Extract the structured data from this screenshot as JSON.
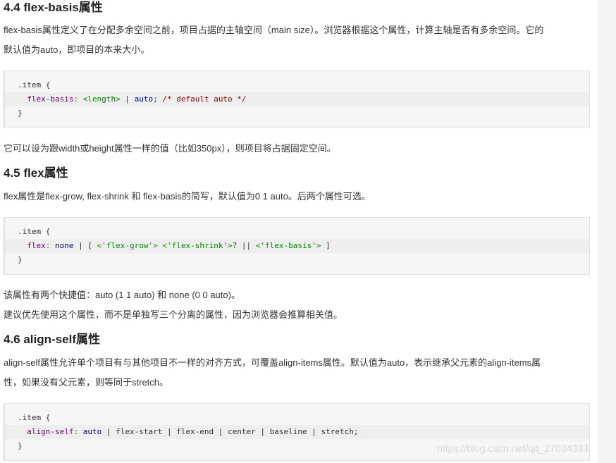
{
  "sections": [
    {
      "heading": "4.4 flex-basis属性",
      "para1_line1": "flex-basis属性定义了在分配多余空间之前，项目占据的主轴空间（main size）。浏览器根据这个属性，计算主轴是否有多余空间。它的",
      "para1_line2": "默认值为auto，即项目的本来大小。",
      "code": {
        "line1": ".item {",
        "line2_prop": "flex-basis",
        "line2_colon": ": ",
        "line2_a": "<length>",
        "line2_sep": " | ",
        "line2_b": "auto",
        "line2_semi": "; ",
        "line2_comment": "/* default auto */",
        "line3": "}"
      },
      "para2": "它可以设为跟width或height属性一样的值（比如350px），则项目将占据固定空间。"
    },
    {
      "heading": "4.5 flex属性",
      "para1": "flex属性是flex-grow, flex-shrink 和 flex-basis的简写，默认值为0 1 auto。后两个属性可选。",
      "code": {
        "line1": ".item {",
        "line2_prop": "flex",
        "line2_colon": ": ",
        "line2_a": "none",
        "line2_rest1": " | [ ",
        "line2_s1": "<'flex-grow'>",
        "line2_sp": " ",
        "line2_s2": "<'flex-shrink'>",
        "line2_rest2": "? || ",
        "line2_s3": "<'flex-basis'>",
        "line2_end": " ]",
        "line3": "}"
      },
      "para2": "该属性有两个快捷值：auto (1 1 auto) 和 none (0 0 auto)。",
      "para3": "建议优先使用这个属性，而不是单独写三个分离的属性，因为浏览器会推算相关值。"
    },
    {
      "heading": "4.6 align-self属性",
      "para1_line1": "align-self属性允许单个项目有与其他项目不一样的对齐方式，可覆盖align-items属性。默认值为auto，表示继承父元素的align-items属",
      "para1_line2": "性，如果没有父元素，则等同于stretch。",
      "code": {
        "line1": ".item {",
        "line2_prop": "align-self",
        "line2_colon": ": ",
        "line2_a": "auto",
        "line2_rest": " | flex-start | flex-end | center | baseline | stretch;",
        "line3": "}"
      }
    }
  ],
  "watermark": "https://blog.csdn.net/qq_27034333"
}
